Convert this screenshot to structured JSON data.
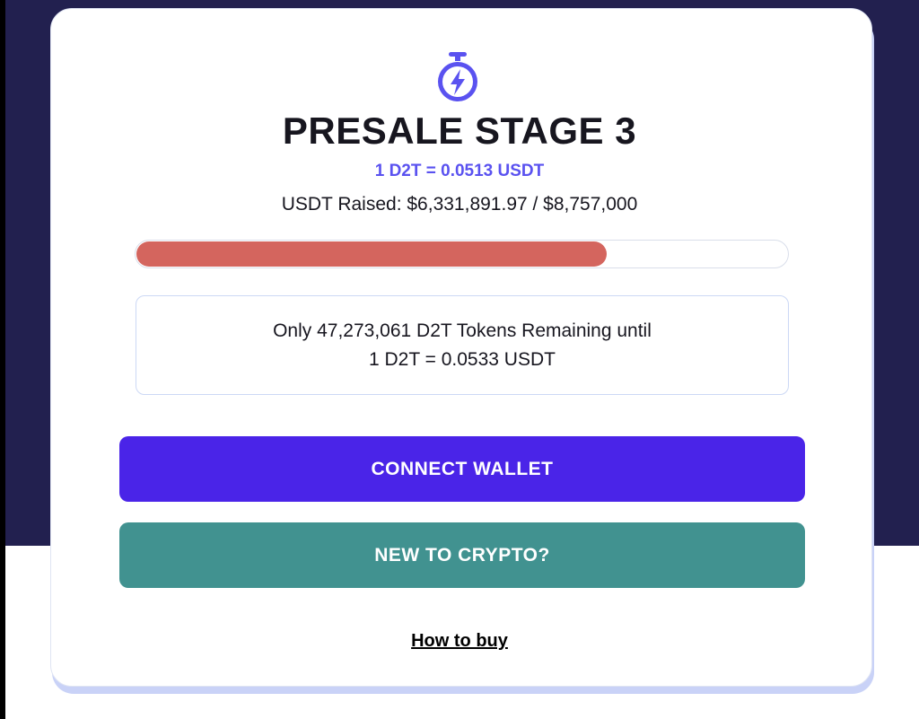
{
  "presale": {
    "icon": "stopwatch-lightning-icon",
    "title": "PRESALE STAGE 3",
    "current_price": "1 D2T = 0.0513 USDT",
    "raised_text": "USDT Raised: $6,331,891.97 / $8,757,000",
    "progress_fraction": 0.723,
    "remaining_line1": "Only 47,273,061 D2T Tokens Remaining until",
    "remaining_line2": "1 D2T = 0.0533 USDT"
  },
  "buttons": {
    "connect_wallet": "CONNECT WALLET",
    "new_to_crypto": "NEW TO CRYPTO?"
  },
  "links": {
    "how_to_buy": "How to buy"
  },
  "colors": {
    "accent": "#5a52f0",
    "connect_button": "#4a24e8",
    "new_button": "#419290",
    "progress": "#d4655e",
    "background_dark": "#22204f"
  }
}
